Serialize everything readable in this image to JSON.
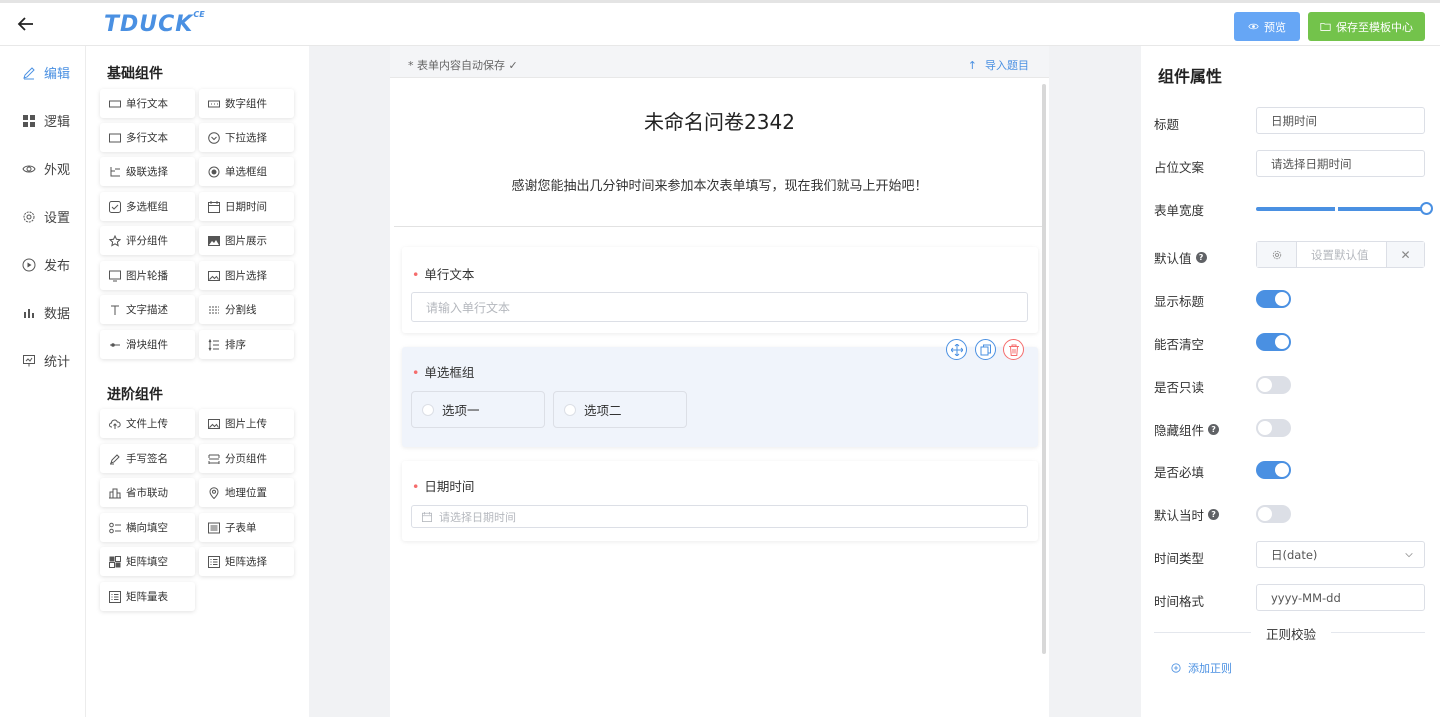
{
  "header": {
    "logo": "TDUCK",
    "logo_sup": "CE",
    "preview_label": "预览",
    "save_label": "保存至模板中心"
  },
  "nav": {
    "items": [
      {
        "label": "编辑",
        "icon": "edit-icon",
        "active": true
      },
      {
        "label": "逻辑",
        "icon": "grid-icon"
      },
      {
        "label": "外观",
        "icon": "eye-icon"
      },
      {
        "label": "设置",
        "icon": "gear-icon"
      },
      {
        "label": "发布",
        "icon": "play-icon"
      },
      {
        "label": "数据",
        "icon": "bar-chart-icon"
      },
      {
        "label": "统计",
        "icon": "presentation-icon"
      }
    ]
  },
  "components": {
    "basic_title": "基础组件",
    "basic": [
      {
        "label": "单行文本",
        "icon": "input-icon"
      },
      {
        "label": "数字组件",
        "icon": "number-icon"
      },
      {
        "label": "多行文本",
        "icon": "textarea-icon"
      },
      {
        "label": "下拉选择",
        "icon": "dropdown-icon"
      },
      {
        "label": "级联选择",
        "icon": "cascader-icon"
      },
      {
        "label": "单选框组",
        "icon": "radio-icon"
      },
      {
        "label": "多选框组",
        "icon": "checkbox-icon"
      },
      {
        "label": "日期时间",
        "icon": "calendar-icon"
      },
      {
        "label": "评分组件",
        "icon": "star-icon"
      },
      {
        "label": "图片展示",
        "icon": "image-icon"
      },
      {
        "label": "图片轮播",
        "icon": "carousel-icon"
      },
      {
        "label": "图片选择",
        "icon": "image-select-icon"
      },
      {
        "label": "文字描述",
        "icon": "text-icon"
      },
      {
        "label": "分割线",
        "icon": "divider-icon"
      },
      {
        "label": "滑块组件",
        "icon": "slider-icon"
      },
      {
        "label": "排序",
        "icon": "sort-icon"
      }
    ],
    "advanced_title": "进阶组件",
    "advanced": [
      {
        "label": "文件上传",
        "icon": "cloud-upload-icon"
      },
      {
        "label": "图片上传",
        "icon": "image-upload-icon"
      },
      {
        "label": "手写签名",
        "icon": "pen-icon"
      },
      {
        "label": "分页组件",
        "icon": "pagination-icon"
      },
      {
        "label": "省市联动",
        "icon": "city-icon"
      },
      {
        "label": "地理位置",
        "icon": "location-icon"
      },
      {
        "label": "横向填空",
        "icon": "horizontal-fill-icon"
      },
      {
        "label": "子表单",
        "icon": "subform-icon"
      },
      {
        "label": "矩阵填空",
        "icon": "matrix-fill-icon"
      },
      {
        "label": "矩阵选择",
        "icon": "matrix-select-icon"
      },
      {
        "label": "矩阵量表",
        "icon": "matrix-scale-icon"
      }
    ]
  },
  "canvas": {
    "autosave": "* 表单内容自动保存 ✓",
    "import_label": "导入题目",
    "form_title": "未命名问卷2342",
    "form_desc": "感谢您能抽出几分钟时间来参加本次表单填写，现在我们就马上开始吧！",
    "fields": {
      "text_label": "单行文本",
      "text_placeholder": "请输入单行文本",
      "radio_label": "单选框组",
      "radio_options": [
        "选项一",
        "选项二"
      ],
      "date_label": "日期时间",
      "date_placeholder": "请选择日期时间"
    }
  },
  "props": {
    "title": "组件属性",
    "label_title": "标题",
    "value_title": "日期时间",
    "label_placeholder": "占位文案",
    "value_placeholder": "请选择日期时间",
    "label_width": "表单宽度",
    "width_percent": 100,
    "label_default": "默认值",
    "default_placeholder": "设置默认值",
    "label_show_title": "显示标题",
    "show_title": true,
    "label_clearable": "能否清空",
    "clearable": true,
    "label_readonly": "是否只读",
    "readonly": false,
    "label_hidden": "隐藏组件",
    "hidden": false,
    "label_required": "是否必填",
    "required": true,
    "label_default_now": "默认当时",
    "default_now": false,
    "label_time_type": "时间类型",
    "time_type": "日(date)",
    "label_time_format": "时间格式",
    "time_format": "yyyy-MM-dd",
    "regex_section": "正则校验",
    "add_regex": "添加正则"
  },
  "colors": {
    "primary": "#4a90e2",
    "success": "#73c34b",
    "danger": "#f56c6c"
  }
}
